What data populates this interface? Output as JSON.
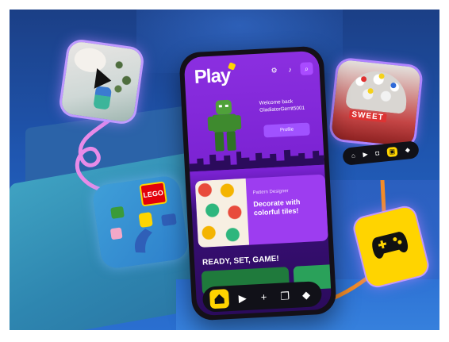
{
  "app": {
    "brand": "Play",
    "welcome_line": "Welcome back",
    "username": "GladiatorGerrit5001",
    "profile_button": "Profile"
  },
  "top_icons": [
    "settings-icon",
    "bell-icon",
    "search-icon"
  ],
  "promo": {
    "kicker": "Pattern Designer",
    "title": "Decorate with colorful tiles!"
  },
  "section": {
    "title": "READY, SET, GAME!"
  },
  "navbar": {
    "items": [
      "home-icon",
      "play-icon",
      "plus-icon",
      "gallery-icon",
      "gamepad-icon"
    ]
  },
  "floating_cards": {
    "lego_logo": "LEGO",
    "dessert_sign": "SWEET"
  },
  "colors": {
    "background": "#1f56b0",
    "phone_purple": "#8b2fe0",
    "accent_yellow": "#ffd400",
    "lego_red": "#e3000b"
  }
}
